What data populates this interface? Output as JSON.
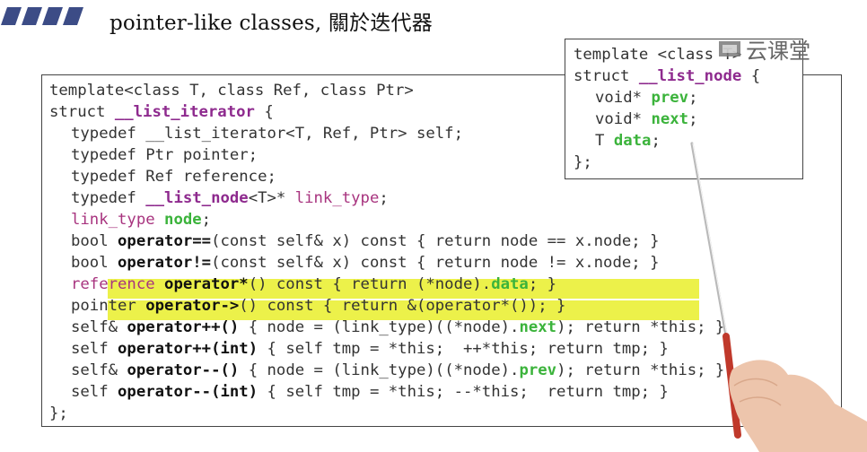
{
  "slide": {
    "title": "pointer-like classes, 關於迭代器",
    "watermark": "云课堂"
  },
  "iterator_code": {
    "lines": [
      "template<class T, class Ref, class Ptr>",
      "struct __list_iterator {",
      "  typedef __list_iterator<T, Ref, Ptr> self;",
      "  typedef Ptr pointer;",
      "  typedef Ref reference;",
      "  typedef __list_node<T>* link_type;",
      "  link_type node;",
      "  bool operator==(const self& x) const { return node == x.node; }",
      "  bool operator!=(const self& x) const { return node != x.node; }",
      "  reference operator*() const { return (*node).data; }",
      "  pointer operator->() const { return &(operator*()); }",
      "  self& operator++() { node = (link_type)((*node).next); return *this; }",
      "  self operator++(int) { self tmp = *this;  ++*this; return tmp; }",
      "  self& operator--() { node = (link_type)((*node).prev); return *this; }",
      "  self operator--(int) { self tmp = *this; --*this;  return tmp; }",
      "};"
    ],
    "highlighted_lines": [
      9,
      10
    ]
  },
  "node_code": {
    "lines": [
      "template <class T>",
      "struct __list_node {",
      "  void* prev;",
      "  void* next;",
      "  T data;",
      "};"
    ]
  },
  "colors": {
    "keyword": "#8e2a8e",
    "member": "#3bb33b",
    "highlight": "#ecf14a",
    "title_bars": "#3c4c86"
  }
}
